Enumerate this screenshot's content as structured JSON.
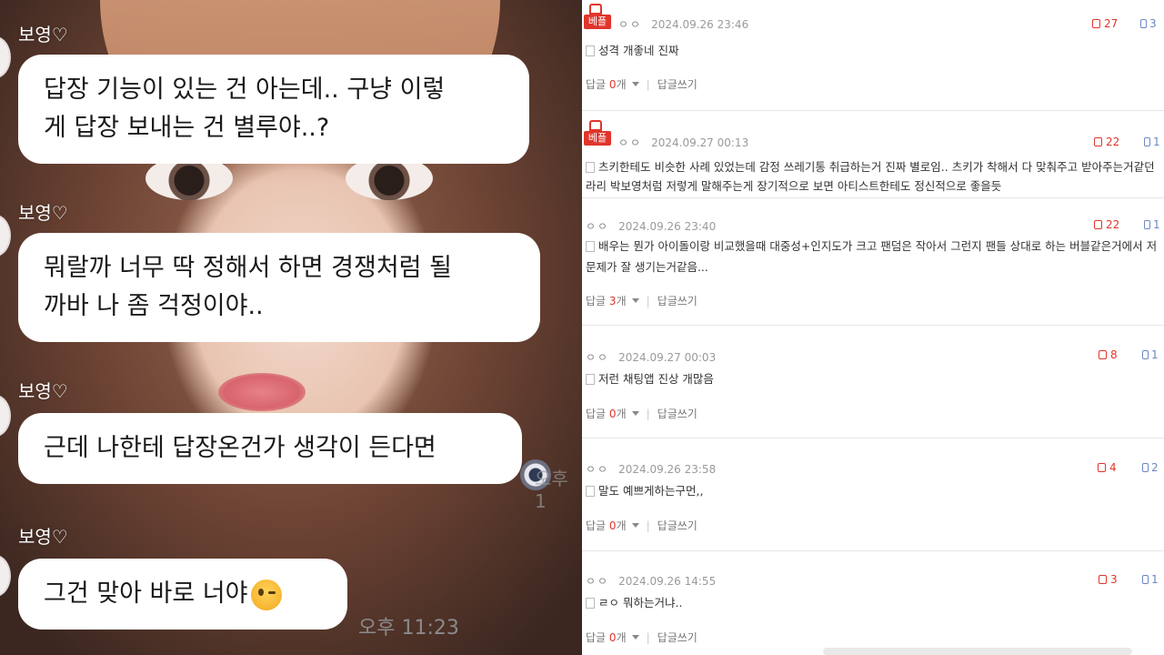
{
  "chat": {
    "sender_name": "보영♡",
    "messages": [
      {
        "line1": "답장 기능이 있는 건 아는데.. 구냥 이렇",
        "line2": "게 답장 보내는 건 별루야..?"
      },
      {
        "line1": "뭐랄까 너무 딱 정해서 하면 경쟁처럼 될",
        "line2": "까바 나 좀 걱정이야.."
      },
      {
        "line1": "근데 나한테 답장온건가 생각이 든다면"
      },
      {
        "line1": "그건 맞아 바로 너야",
        "emoji": "wink-emoji"
      }
    ],
    "time": "오후 11:23",
    "partial_time": "오후 1"
  },
  "comments": {
    "best_label": "베플",
    "reply_label": "답글",
    "write_reply_label": "답글쓰기",
    "items": [
      {
        "best": true,
        "nick": "ㅇㅇ",
        "date": "2024.09.26 23:46",
        "text1": "성격 개좋네 진짜",
        "text2": "",
        "replies": "0",
        "count_suffix": "개",
        "likes": "27",
        "dislikes": "3"
      },
      {
        "best": true,
        "nick": "ㅇㅇ",
        "date": "2024.09.27 00:13",
        "text1": "츠키한테도 비슷한 사례 있었는데 감정 쓰레기통 취급하는거 진짜 별로임.. 츠키가 착해서 다 맞춰주고 받아주는거같던",
        "text2": "라리 박보영처럼 저렇게 말해주는게 장기적으로 보면 아티스트한테도 정신적으로 좋을듯",
        "replies": "",
        "count_suffix": "",
        "likes": "22",
        "dislikes": "1"
      },
      {
        "best": false,
        "nick": "ㅇㅇ",
        "date": "2024.09.26 23:40",
        "text1": "배우는 뭔가 아이돌이랑 비교했을때 대중성+인지도가 크고 팬덤은 작아서 그런지 팬들 상대로 하는 버블같은거에서 저",
        "text2": "문제가 잘 생기는거같음...",
        "replies": "3",
        "count_suffix": "개",
        "likes": "22",
        "dislikes": "1"
      },
      {
        "best": false,
        "nick": "ㅇㅇ",
        "date": "2024.09.27 00:03",
        "text1": "저런 채팅앱 진상 개많음",
        "text2": "",
        "replies": "0",
        "count_suffix": "개",
        "likes": "8",
        "dislikes": "1"
      },
      {
        "best": false,
        "nick": "ㅇㅇ",
        "date": "2024.09.26 23:58",
        "text1": "말도 예쁘게하는구먼,,",
        "text2": "",
        "replies": "0",
        "count_suffix": "개",
        "likes": "4",
        "dislikes": "2"
      },
      {
        "best": false,
        "nick": "ㅇㅇ",
        "date": "2024.09.26 14:55",
        "text1": "ㄹㅇ 뭐하는거냐..",
        "text2": "",
        "replies": "0",
        "count_suffix": "개",
        "likes": "3",
        "dislikes": "1"
      }
    ]
  },
  "colors": {
    "accent_red": "#e0352b",
    "dislike_blue": "#6b87c4"
  }
}
